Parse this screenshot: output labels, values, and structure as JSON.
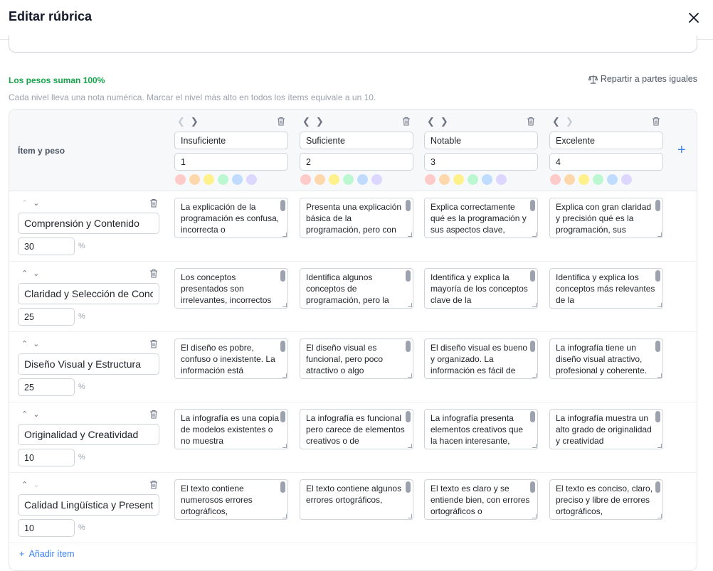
{
  "header": {
    "title": "Editar rúbrica"
  },
  "status": {
    "weights_ok": "Los pesos suman 100%",
    "distribute_label": "Repartir a partes iguales",
    "hint": "Cada nivel lleva una nota numérica. Marcar el nivel más alto en todos los ítems equivale a un 10."
  },
  "table": {
    "item_column_title": "Ítem y peso",
    "palette": [
      "#fecaca",
      "#fed7aa",
      "#fef08a",
      "#bbf7d0",
      "#bfdbfe",
      "#ddd6fe"
    ],
    "levels": [
      {
        "name": "Insuficiente",
        "score": "1"
      },
      {
        "name": "Suficiente",
        "score": "2"
      },
      {
        "name": "Notable",
        "score": "3"
      },
      {
        "name": "Excelente",
        "score": "4"
      }
    ],
    "percent_symbol": "%",
    "add_item_label": "Añadir ítem",
    "items": [
      {
        "name": "Comprensión y Contenido",
        "weight": "30",
        "descriptors": [
          "La explicación de la programación es confusa, incorrecta o",
          "Presenta una explicación básica de la programación, pero con",
          "Explica correctamente qué es la programación y sus aspectos clave,",
          "Explica con gran claridad y precisión qué es la programación, sus"
        ]
      },
      {
        "name": "Claridad y Selección de Conceptos",
        "weight": "25",
        "descriptors": [
          "Los conceptos presentados son irrelevantes, incorrectos",
          "Identifica algunos conceptos de programación, pero la",
          "Identifica y explica la mayoría de los conceptos clave de la",
          "Identifica y explica los conceptos más relevantes de la"
        ]
      },
      {
        "name": "Diseño Visual y Estructura",
        "weight": "25",
        "descriptors": [
          "El diseño es pobre, confuso o inexistente. La información está",
          "El diseño visual es funcional, pero poco atractivo o algo",
          "El diseño visual es bueno y organizado. La información es fácil de",
          "La infografía tiene un diseño visual atractivo, profesional y coherente."
        ]
      },
      {
        "name": "Originalidad y Creatividad",
        "weight": "10",
        "descriptors": [
          "La infografía es una copia de modelos existentes o no muestra",
          "La infografía es funcional pero carece de elementos creativos o de",
          "La infografía presenta elementos creativos que la hacen interesante,",
          "La infografía muestra un alto grado de originalidad y creatividad"
        ]
      },
      {
        "name": "Calidad Lingüística y Presentación",
        "weight": "10",
        "descriptors": [
          "El texto contiene numerosos errores ortográficos,",
          "El texto contiene algunos errores ortográficos,",
          "El texto es claro y se entiende bien, con errores ortográficos o",
          "El texto es conciso, claro, preciso y libre de errores ortográficos,"
        ]
      }
    ]
  }
}
